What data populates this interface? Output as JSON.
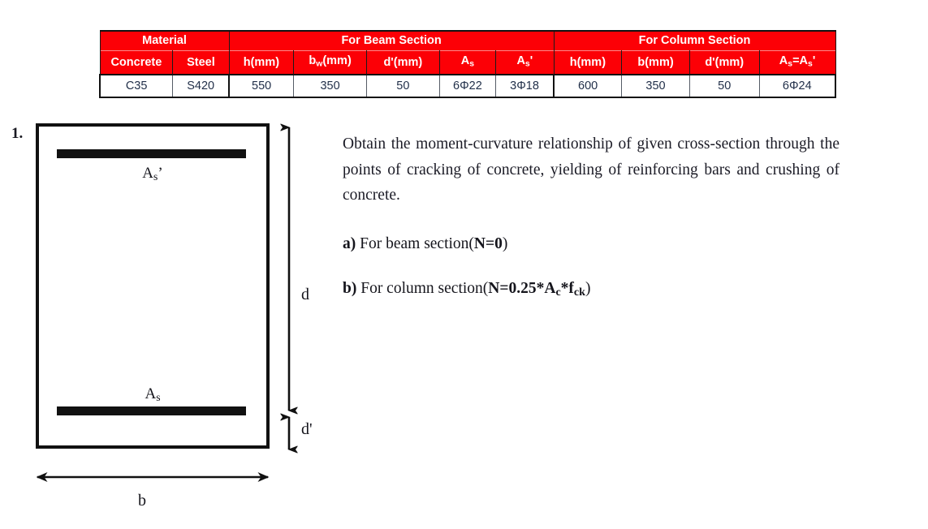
{
  "table": {
    "groups": [
      {
        "label": "Material",
        "span": 2
      },
      {
        "label": "For Beam Section",
        "span": 5
      },
      {
        "label": "For Column Section",
        "span": 4
      }
    ],
    "columns": [
      {
        "label": "Concrete",
        "html": "Concrete"
      },
      {
        "label": "Steel",
        "html": "Steel"
      },
      {
        "label": "h(mm)",
        "html": "h(mm)"
      },
      {
        "label": "bw(mm)",
        "html": "b<span class=\"sub\">w</span>(mm)"
      },
      {
        "label": "d'(mm)",
        "html": "d'(mm)"
      },
      {
        "label": "As",
        "html": "A<span class=\"sub\">s</span>"
      },
      {
        "label": "As'",
        "html": "A<span class=\"sub\">s</span>'"
      },
      {
        "label": "h(mm)",
        "html": "h(mm)"
      },
      {
        "label": "b(mm)",
        "html": "b(mm)"
      },
      {
        "label": "d'(mm)",
        "html": "d'(mm)"
      },
      {
        "label": "As=As'",
        "html": "A<span class=\"sub\">s</span>=A<span class=\"sub\">s</span>'"
      }
    ],
    "values": [
      "C35",
      "S420",
      "550",
      "350",
      "50",
      "6Φ22",
      "3Φ18",
      "600",
      "350",
      "50",
      "6Φ24"
    ]
  },
  "figure": {
    "item_number": "1.",
    "label_as_top": "As'",
    "label_as_bottom": "As",
    "dim_d": "d",
    "dim_dprime": "d'",
    "dim_b": "b"
  },
  "problem": {
    "statement": "Obtain the moment-curvature relationship of given cross-section through the points of cracking of concrete, yielding of reinforcing bars and crushing of concrete.",
    "task_a": "a) For beam section(N=0)",
    "task_a_marker": "a)",
    "task_a_text": "For beam section(",
    "task_a_bold": "N=0",
    "task_b_marker": "b)",
    "task_b_text": "For column section(",
    "task_b_bold": "N=0.25*Ac*fck"
  },
  "colors": {
    "header_red": "#fc0006",
    "header_text": "#ffffff",
    "data_text": "#22304a",
    "ink": "#111111"
  }
}
